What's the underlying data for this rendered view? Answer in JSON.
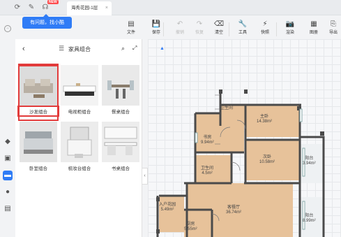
{
  "tabbar": {
    "icons": [
      "refresh-icon",
      "pen-icon",
      "headset-icon"
    ],
    "new_badge": "NEW",
    "doc_tab_title": "海秀花园-1层",
    "doc_tab_close": "×"
  },
  "tooltip": {
    "text": "有问题，找小酷"
  },
  "toolbar": {
    "items": [
      {
        "label": "文件",
        "icon": "file-icon",
        "glyph": "▤",
        "enabled": true
      },
      {
        "label": "保存",
        "icon": "save-icon",
        "glyph": "💾",
        "enabled": true
      },
      {
        "label": "撤销",
        "icon": "undo-icon",
        "glyph": "↶",
        "enabled": false
      },
      {
        "label": "恢复",
        "icon": "redo-icon",
        "glyph": "↷",
        "enabled": false
      },
      {
        "label": "清空",
        "icon": "clear-icon",
        "glyph": "⌫",
        "enabled": true
      },
      {
        "label": "工具",
        "icon": "wrench-icon",
        "glyph": "🔧",
        "enabled": true
      },
      {
        "label": "快照",
        "icon": "lightning-icon",
        "glyph": "⚡",
        "enabled": true
      },
      {
        "label": "渲染",
        "icon": "camera-icon",
        "glyph": "📷",
        "enabled": true
      },
      {
        "label": "图册",
        "icon": "album-icon",
        "glyph": "▦",
        "enabled": true
      },
      {
        "label": "导出",
        "icon": "export-icon",
        "glyph": "⎘",
        "enabled": true
      }
    ]
  },
  "panel": {
    "title": "家具组合",
    "cards": [
      {
        "label": "沙发组合",
        "selected": true
      },
      {
        "label": "电视柜组合",
        "selected": false
      },
      {
        "label": "餐桌组合",
        "selected": false
      },
      {
        "label": "卧室组合",
        "selected": false
      },
      {
        "label": "梳妆台组合",
        "selected": false
      },
      {
        "label": "书桌组合",
        "selected": false
      }
    ]
  },
  "canvas": {
    "rooms": [
      {
        "name": "卫生间",
        "area": ""
      },
      {
        "name": "主卧",
        "area": "14.38m²"
      },
      {
        "name": "书房",
        "area": "9.94m²"
      },
      {
        "name": "次卧",
        "area": "10.58m²"
      },
      {
        "name": "阳台",
        "area": "3.94m²"
      },
      {
        "name": "卫生间",
        "area": "4.5m²"
      },
      {
        "name": "入户花园",
        "area": "5.49m²"
      },
      {
        "name": "客餐厅",
        "area": "36.74m²"
      },
      {
        "name": "厨房",
        "area": "5.55m²"
      },
      {
        "name": "阳台",
        "area": "8.99m²"
      }
    ]
  },
  "colors": {
    "accent": "#2f7cf6",
    "selection": "#e23b3b",
    "wall": "#4a4a4a",
    "floor": "#d9a977"
  }
}
